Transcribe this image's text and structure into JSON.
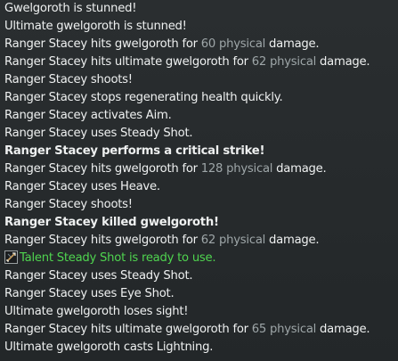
{
  "combat_log": {
    "lines": [
      {
        "style": "normal",
        "segments": [
          {
            "text": "Gwelgoroth is stunned!",
            "kind": "normal"
          }
        ]
      },
      {
        "style": "normal",
        "segments": [
          {
            "text": "Ultimate gwelgoroth is stunned!",
            "kind": "normal"
          }
        ]
      },
      {
        "style": "normal",
        "segments": [
          {
            "text": "Ranger Stacey hits gwelgoroth for ",
            "kind": "normal"
          },
          {
            "text": "60 physical",
            "kind": "value"
          },
          {
            "text": " damage.",
            "kind": "normal"
          }
        ]
      },
      {
        "style": "normal",
        "segments": [
          {
            "text": "Ranger Stacey hits ultimate gwelgoroth for ",
            "kind": "normal"
          },
          {
            "text": "62 physical",
            "kind": "value"
          },
          {
            "text": " damage.",
            "kind": "normal"
          }
        ]
      },
      {
        "style": "normal",
        "segments": [
          {
            "text": "Ranger Stacey shoots!",
            "kind": "normal"
          }
        ]
      },
      {
        "style": "normal",
        "segments": [
          {
            "text": "Ranger Stacey stops regenerating health quickly.",
            "kind": "normal"
          }
        ]
      },
      {
        "style": "normal",
        "segments": [
          {
            "text": "Ranger Stacey activates Aim.",
            "kind": "normal"
          }
        ]
      },
      {
        "style": "normal",
        "segments": [
          {
            "text": "Ranger Stacey uses Steady Shot.",
            "kind": "normal"
          }
        ]
      },
      {
        "style": "bold",
        "segments": [
          {
            "text": "Ranger Stacey performs a critical strike!",
            "kind": "normal"
          }
        ]
      },
      {
        "style": "normal",
        "segments": [
          {
            "text": "Ranger Stacey hits gwelgoroth for ",
            "kind": "normal"
          },
          {
            "text": "128 physical",
            "kind": "value"
          },
          {
            "text": " damage.",
            "kind": "normal"
          }
        ]
      },
      {
        "style": "normal",
        "segments": [
          {
            "text": "Ranger Stacey uses Heave.",
            "kind": "normal"
          }
        ]
      },
      {
        "style": "normal",
        "segments": [
          {
            "text": "Ranger Stacey shoots!",
            "kind": "normal"
          }
        ]
      },
      {
        "style": "bold",
        "segments": [
          {
            "text": "Ranger Stacey killed gwelgoroth!",
            "kind": "normal"
          }
        ]
      },
      {
        "style": "normal",
        "segments": [
          {
            "text": "Ranger Stacey hits gwelgoroth for ",
            "kind": "normal"
          },
          {
            "text": "62 physical",
            "kind": "value"
          },
          {
            "text": " damage.",
            "kind": "normal"
          }
        ]
      },
      {
        "style": "talent",
        "icon": "steady-shot-talent-icon",
        "segments": [
          {
            "text": "Talent Steady Shot is ready to use.",
            "kind": "normal"
          }
        ]
      },
      {
        "style": "normal",
        "segments": [
          {
            "text": "Ranger Stacey uses Steady Shot.",
            "kind": "normal"
          }
        ]
      },
      {
        "style": "normal",
        "segments": [
          {
            "text": "Ranger Stacey uses Eye Shot.",
            "kind": "normal"
          }
        ]
      },
      {
        "style": "normal",
        "segments": [
          {
            "text": "Ultimate gwelgoroth loses sight!",
            "kind": "normal"
          }
        ]
      },
      {
        "style": "normal",
        "segments": [
          {
            "text": "Ranger Stacey hits ultimate gwelgoroth for ",
            "kind": "normal"
          },
          {
            "text": "65 physical",
            "kind": "value"
          },
          {
            "text": " damage.",
            "kind": "normal"
          }
        ]
      },
      {
        "style": "normal",
        "segments": [
          {
            "text": "Ultimate gwelgoroth casts Lightning.",
            "kind": "normal"
          }
        ]
      }
    ]
  },
  "colors": {
    "background": "#262a2c",
    "text": "#eef0f0",
    "damage_value": "#9ea6a8",
    "talent_ready": "#4fd44f"
  }
}
